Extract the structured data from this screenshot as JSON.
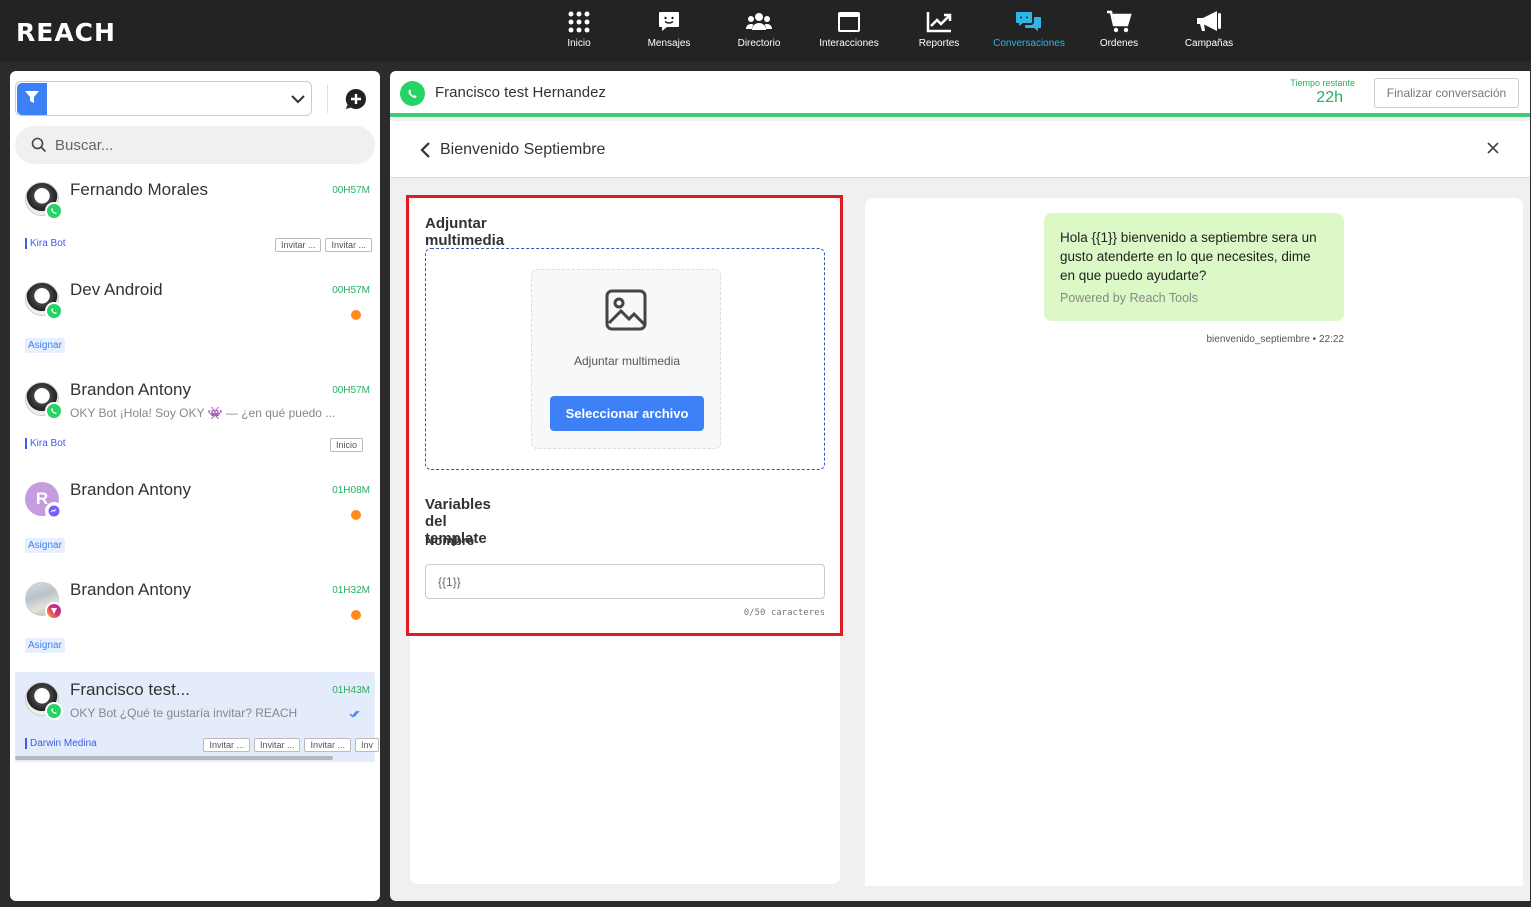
{
  "app": {
    "logo": "REACH"
  },
  "nav": [
    {
      "label": "Inicio",
      "icon": "grid-icon"
    },
    {
      "label": "Mensajes",
      "icon": "message-icon"
    },
    {
      "label": "Directorio",
      "icon": "users-icon"
    },
    {
      "label": "Interacciones",
      "icon": "window-icon"
    },
    {
      "label": "Reportes",
      "icon": "chart-icon"
    },
    {
      "label": "Conversaciones",
      "icon": "chat-bubbles-icon",
      "active": true
    },
    {
      "label": "Ordenes",
      "icon": "cart-icon"
    },
    {
      "label": "Campañas",
      "icon": "megaphone-icon"
    }
  ],
  "sidebar": {
    "filter_value": "",
    "search_placeholder": "Buscar...",
    "conversations": [
      {
        "name": "Fernando Morales",
        "time": "00H57M",
        "preview": "",
        "channel": "whatsapp",
        "agent": "Kira Bot",
        "tags": [
          "Invitar ...",
          "Invitar ..."
        ]
      },
      {
        "name": "Dev Android",
        "time": "00H57M",
        "preview": "",
        "channel": "whatsapp",
        "assign": "Asignar",
        "unread": true
      },
      {
        "name": "Brandon Antony",
        "time": "00H57M",
        "preview": "OKY Bot ¡Hola! Soy OKY 👾 — ¿en qué puedo ...",
        "channel": "whatsapp",
        "agent": "Kira Bot",
        "tags": [
          "Inicio"
        ]
      },
      {
        "name": "Brandon Antony",
        "time": "01H08M",
        "preview": "",
        "channel": "messenger",
        "avatar_letter": "R",
        "assign": "Asignar",
        "unread": true
      },
      {
        "name": "Brandon Antony",
        "time": "01H32M",
        "preview": "",
        "channel": "instagram",
        "assign": "Asignar",
        "unread": true
      },
      {
        "name": "Francisco test...",
        "time": "01H43M",
        "preview": "OKY Bot ¿Qué te gustaría invitar? REACH",
        "channel": "whatsapp",
        "agent": "Darwin Medina",
        "tags": [
          "Invitar ...",
          "Invitar ...",
          "Invitar ...",
          "Inv"
        ],
        "selected": true
      }
    ]
  },
  "chat": {
    "contact_name": "Francisco test Hernandez",
    "timer_label": "Tiempo restante",
    "timer_value": "22h",
    "end_button": "Finalizar conversación"
  },
  "template": {
    "title": "Bienvenido Septiembre",
    "attach_title": "Adjuntar multimedia",
    "attach_box_text": "Adjuntar multimedia",
    "select_button": "Seleccionar archivo",
    "variables_title": "Variables del template",
    "field_label": "Nombre",
    "field_value": "{{1}}",
    "char_count": "0/50",
    "char_label": "caracteres"
  },
  "preview": {
    "message": "Hola {{1}} bienvenido a septiembre sera un gusto atenderte en lo que necesites, dime en que puedo ayudarte?",
    "footer": "Powered by Reach Tools",
    "meta": "bienvenido_septiembre • 22:22"
  },
  "colors": {
    "accent": "#3d7ff5",
    "success": "#27ae60",
    "highlight": "#e01b24",
    "bubble": "#dcf8c6",
    "topbar": "#232323"
  }
}
